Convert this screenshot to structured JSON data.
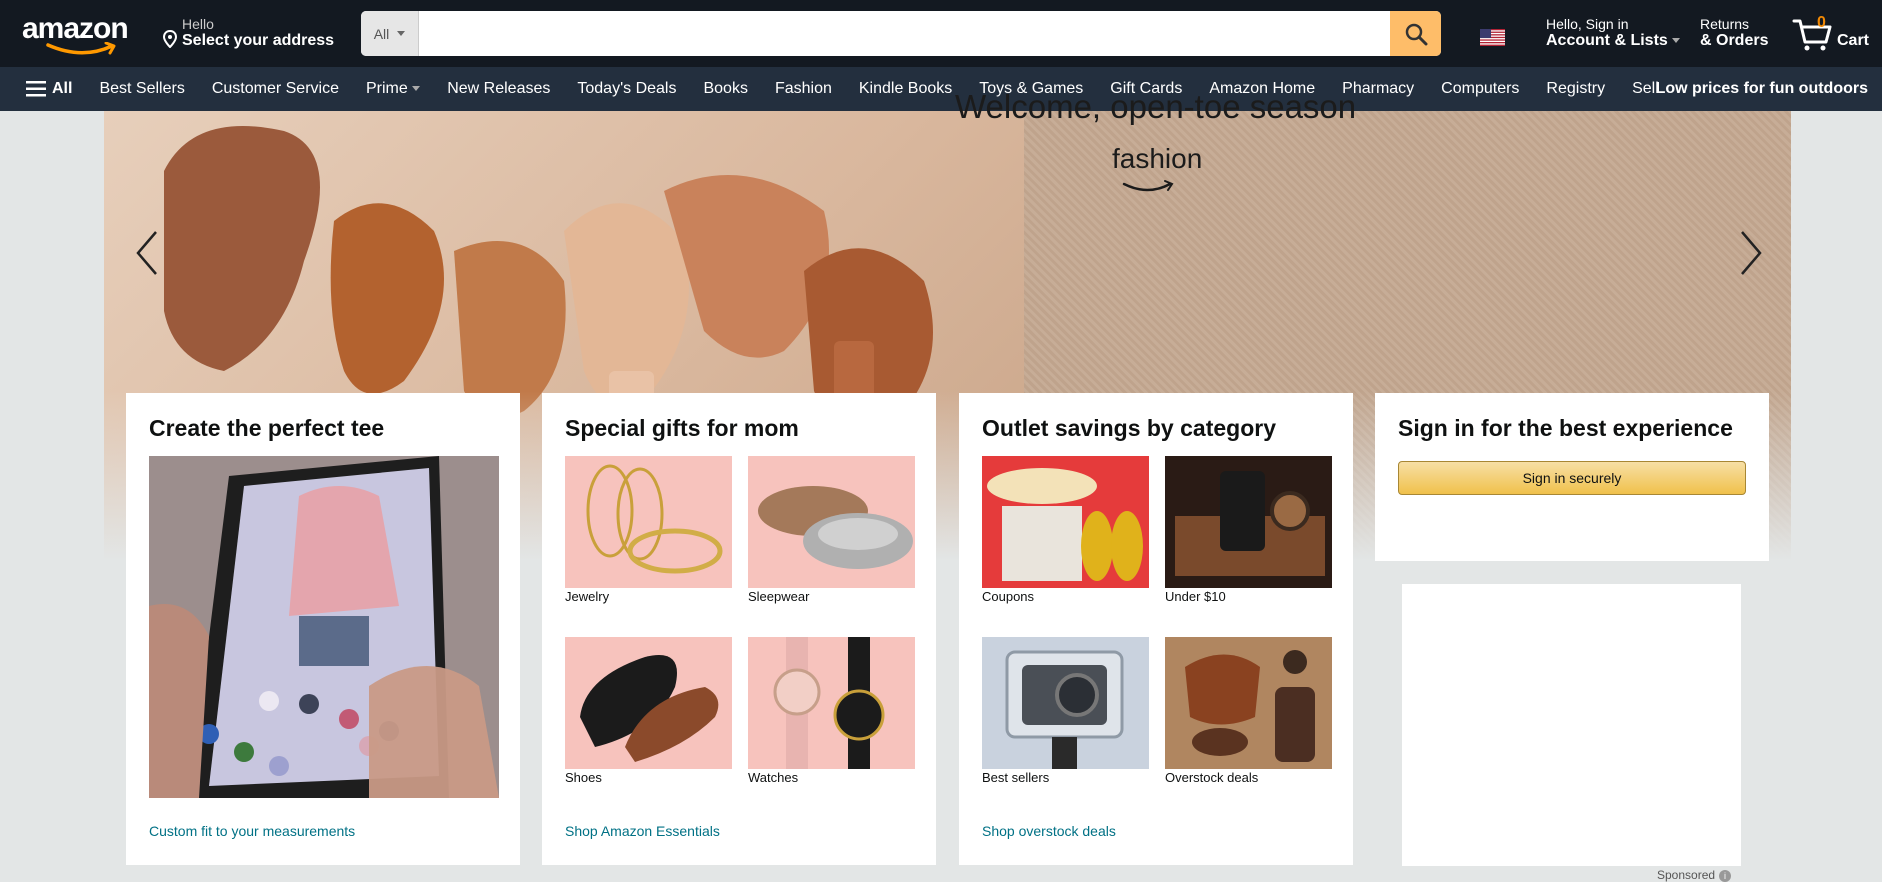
{
  "header": {
    "logo_text": "amazon",
    "location_line1": "Hello",
    "location_line2": "Select your address",
    "search_category": "All",
    "search_placeholder": "",
    "account_line1": "Hello, Sign in",
    "account_line2": "Account & Lists",
    "returns_line1": "Returns",
    "returns_line2": "& Orders",
    "cart_count": "0",
    "cart_label": "Cart"
  },
  "nav": {
    "all_label": "All",
    "items": [
      "Best Sellers",
      "Customer Service",
      "Prime",
      "New Releases",
      "Today's Deals",
      "Books",
      "Fashion",
      "Kindle Books",
      "Toys & Games",
      "Gift Cards",
      "Amazon Home",
      "Pharmacy",
      "Computers",
      "Registry",
      "Sell"
    ],
    "promo": "Low prices for fun outdoors"
  },
  "hero": {
    "title": "Welcome, open-toe season",
    "brand": "fashion"
  },
  "cards": {
    "tee": {
      "title": "Create the perfect tee",
      "link": "Custom fit to your measurements"
    },
    "mom": {
      "title": "Special gifts for mom",
      "items": [
        "Jewelry",
        "Sleepwear",
        "Shoes",
        "Watches"
      ],
      "link": "Shop Amazon Essentials"
    },
    "outlet": {
      "title": "Outlet savings by category",
      "items": [
        "Coupons",
        "Under $10",
        "Best sellers",
        "Overstock deals"
      ],
      "link": "Shop overstock deals"
    },
    "signin": {
      "title": "Sign in for the best experience",
      "button": "Sign in securely"
    }
  },
  "ad": {
    "sponsored": "Sponsored"
  },
  "colors": {
    "topbar": "#131921",
    "navbar": "#232f3e",
    "search_button": "#febd69",
    "link": "#007185",
    "cart_count": "#f08804"
  }
}
